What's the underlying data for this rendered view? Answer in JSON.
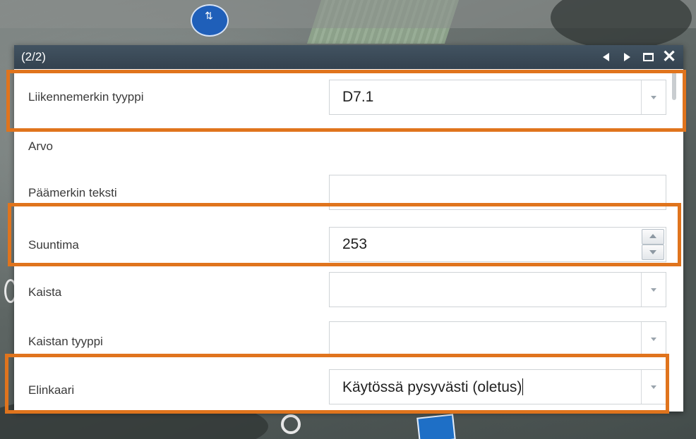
{
  "map": {
    "background_colors": {
      "grass": "#8fa58c",
      "road": "#8c8f8e",
      "sign_blue": "#1f5fb9"
    }
  },
  "popup": {
    "title": "(2/2)",
    "controls": {
      "prev_icon": "triangle-left-icon",
      "next_icon": "triangle-right-icon",
      "maximize_icon": "maximize-icon",
      "close_icon": "close-icon",
      "close_glyph": "✕"
    },
    "fields": [
      {
        "label": "Liikennemerkin tyyppi",
        "value": "D7.1",
        "control": "dropdown",
        "highlighted": true
      },
      {
        "label": "Arvo",
        "value": "",
        "control": "text"
      },
      {
        "label": "Päämerkin teksti",
        "value": "",
        "control": "text"
      },
      {
        "label": "Suuntima",
        "value": "253",
        "control": "number",
        "highlighted": true
      },
      {
        "label": "Kaista",
        "value": "",
        "control": "dropdown"
      },
      {
        "label": "Kaistan tyyppi",
        "value": "",
        "control": "dropdown"
      },
      {
        "label": "Elinkaari",
        "value": "Käytössä pysyvästi (oletus)",
        "control": "dropdown",
        "highlighted": true
      }
    ]
  },
  "colors": {
    "titlebar": "#3a4957",
    "highlight": "#e0741d",
    "field_border": "#cfd3d6"
  }
}
